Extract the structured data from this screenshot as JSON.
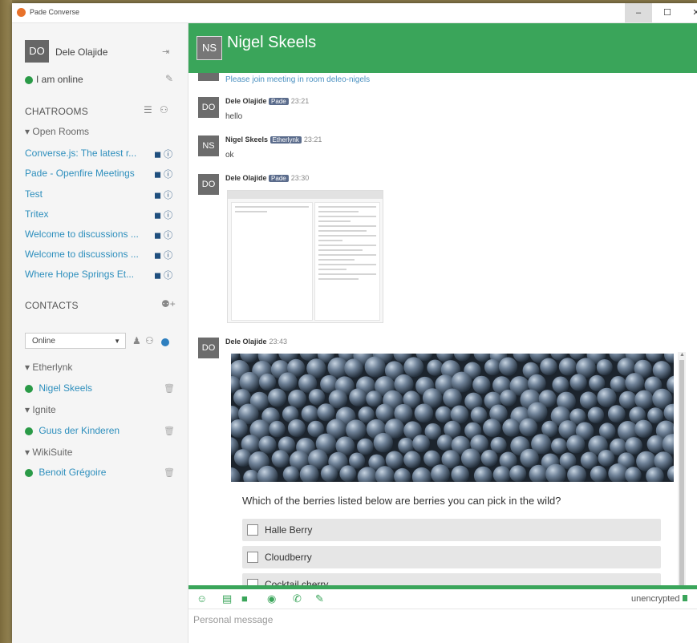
{
  "window": {
    "title": "Pade Converse",
    "min": "–",
    "max": "☐",
    "close": "✕"
  },
  "sidebar": {
    "user": {
      "initials": "DO",
      "name": "Dele Olajide"
    },
    "status": "I am online",
    "chatrooms": {
      "header": "CHATROOMS",
      "group": "Open Rooms",
      "rooms": [
        {
          "label": "Converse.js: The latest r..."
        },
        {
          "label": "Pade - Openfire Meetings"
        },
        {
          "label": "Test"
        },
        {
          "label": "Tritex"
        },
        {
          "label": "Welcome to discussions ..."
        },
        {
          "label": "Welcome to discussions ..."
        },
        {
          "label": "Where Hope Springs Et..."
        }
      ]
    },
    "contacts": {
      "header": "CONTACTS",
      "filter": "Online",
      "groups": [
        {
          "name": "Etherlynk",
          "contacts": [
            {
              "name": "Nigel Skeels"
            }
          ]
        },
        {
          "name": "Ignite",
          "contacts": [
            {
              "name": "Guus der Kinderen"
            }
          ]
        },
        {
          "name": "WikiSuite",
          "contacts": [
            {
              "name": "Benoit Grégoire"
            }
          ]
        }
      ]
    }
  },
  "chat": {
    "initials": "NS",
    "title": "Nigel Skeels",
    "messages": [
      {
        "text": "Please join meeting in room deleo-nigels"
      },
      {
        "initials": "DO",
        "sender": "Dele Olajide",
        "badge": "Pade",
        "time": "23:21",
        "text": "hello"
      },
      {
        "initials": "NS",
        "sender": "Nigel Skeels",
        "badge": "Etherlynk",
        "time": "23:21",
        "text": "ok"
      },
      {
        "initials": "DO",
        "sender": "Dele Olajide",
        "badge": "Pade",
        "time": "23:30"
      },
      {
        "initials": "DO",
        "sender": "Dele Olajide",
        "time": "23:43"
      }
    ],
    "poll": {
      "question": "Which of the berries listed below are berries you can pick in the wild?",
      "options": [
        "Halle Berry",
        "Cloudberry",
        "Cocktail cherry"
      ]
    },
    "encryption": "unencrypted",
    "input_placeholder": "Personal message"
  },
  "colors": {
    "accent": "#3aa55a",
    "link": "#2e8fbd",
    "online": "#2a9a47"
  }
}
